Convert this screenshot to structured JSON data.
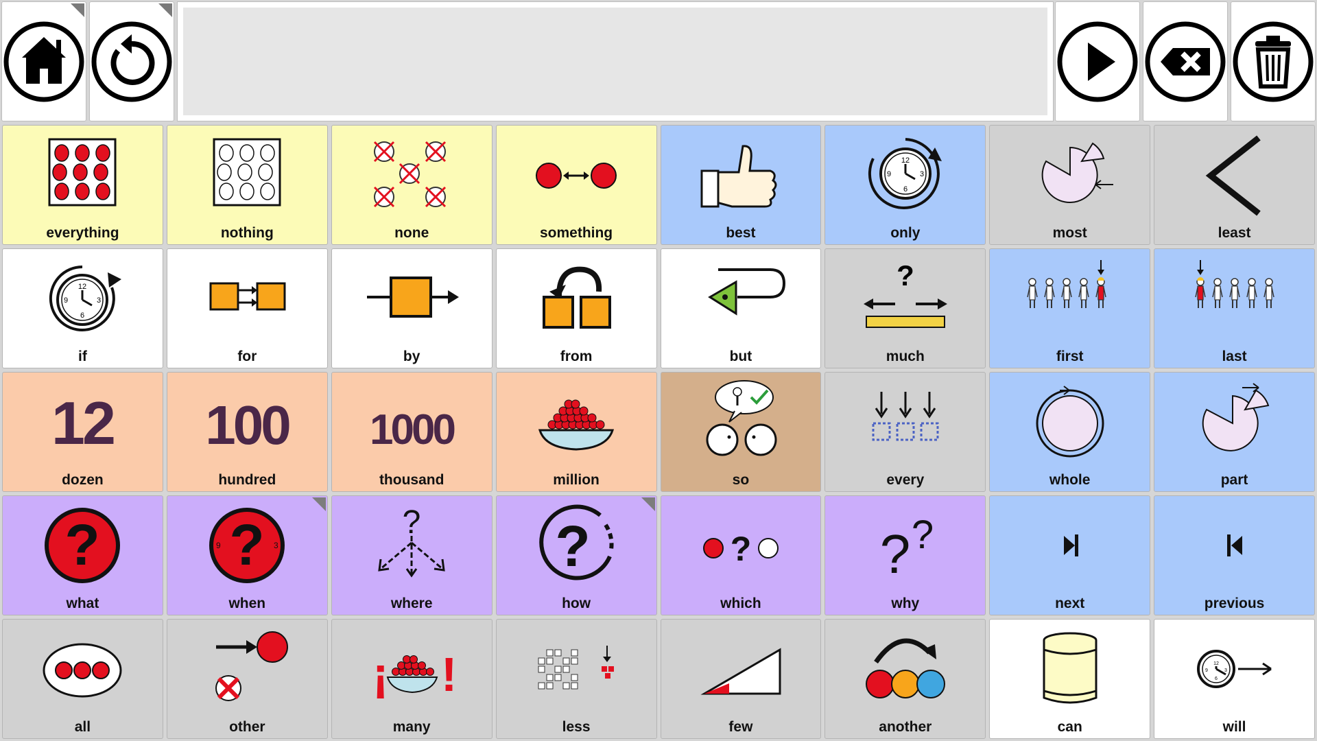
{
  "toolbar": {
    "left": [
      {
        "name": "home-button",
        "icon": "home-icon"
      },
      {
        "name": "back-button",
        "icon": "undo-icon"
      }
    ],
    "right": [
      {
        "name": "speak-button",
        "icon": "play-icon"
      },
      {
        "name": "backspace-button",
        "icon": "backspace-icon"
      },
      {
        "name": "clear-button",
        "icon": "trash-icon"
      }
    ],
    "message": ""
  },
  "colors": {
    "yellow": "#fcfbb7",
    "blue": "#a9c9fb",
    "gray": "#d1d1d1",
    "white": "#ffffff",
    "orange": "#fbcbaa",
    "brown": "#d4af8b",
    "purple": "#cbadfb",
    "red": "#e3101f"
  },
  "grid": [
    {
      "label": "everything",
      "color": "yellow",
      "icon": "everything-icon"
    },
    {
      "label": "nothing",
      "color": "yellow",
      "icon": "nothing-icon"
    },
    {
      "label": "none",
      "color": "yellow",
      "icon": "none-icon"
    },
    {
      "label": "something",
      "color": "yellow",
      "icon": "something-icon"
    },
    {
      "label": "best",
      "color": "blue",
      "icon": "thumbs-up-icon"
    },
    {
      "label": "only",
      "color": "blue",
      "icon": "clock-loop-icon"
    },
    {
      "label": "most",
      "color": "gray",
      "icon": "pie-most-icon"
    },
    {
      "label": "least",
      "color": "gray",
      "icon": "less-than-icon"
    },
    {
      "label": "if",
      "color": "white",
      "icon": "clock-if-icon"
    },
    {
      "label": "for",
      "color": "white",
      "icon": "for-icon"
    },
    {
      "label": "by",
      "color": "white",
      "icon": "by-icon"
    },
    {
      "label": "from",
      "color": "white",
      "icon": "from-icon"
    },
    {
      "label": "but",
      "color": "white",
      "icon": "but-icon"
    },
    {
      "label": "much",
      "color": "gray",
      "icon": "much-icon"
    },
    {
      "label": "first",
      "color": "blue",
      "icon": "first-icon"
    },
    {
      "label": "last",
      "color": "blue",
      "icon": "last-icon"
    },
    {
      "label": "dozen",
      "color": "orange",
      "icon": "number-12-icon",
      "numeral": "12"
    },
    {
      "label": "hundred",
      "color": "orange",
      "icon": "number-100-icon",
      "numeral": "100"
    },
    {
      "label": "thousand",
      "color": "orange",
      "icon": "number-1000-icon",
      "numeral": "1000"
    },
    {
      "label": "million",
      "color": "orange",
      "icon": "bowl-icon"
    },
    {
      "label": "so",
      "color": "brown",
      "icon": "so-icon"
    },
    {
      "label": "every",
      "color": "gray",
      "icon": "every-icon"
    },
    {
      "label": "whole",
      "color": "blue",
      "icon": "whole-icon"
    },
    {
      "label": "part",
      "color": "blue",
      "icon": "part-icon"
    },
    {
      "label": "what",
      "color": "purple",
      "icon": "question-icon"
    },
    {
      "label": "when",
      "color": "purple",
      "icon": "question-clock-icon",
      "folder": true
    },
    {
      "label": "where",
      "color": "purple",
      "icon": "where-icon"
    },
    {
      "label": "how",
      "color": "purple",
      "icon": "how-icon",
      "folder": true
    },
    {
      "label": "which",
      "color": "purple",
      "icon": "which-icon"
    },
    {
      "label": "why",
      "color": "purple",
      "icon": "why-icon"
    },
    {
      "label": "next",
      "color": "blue",
      "icon": "next-icon"
    },
    {
      "label": "previous",
      "color": "blue",
      "icon": "previous-icon"
    },
    {
      "label": "all",
      "color": "gray",
      "icon": "all-icon"
    },
    {
      "label": "other",
      "color": "gray",
      "icon": "other-icon"
    },
    {
      "label": "many",
      "color": "gray",
      "icon": "many-icon"
    },
    {
      "label": "less",
      "color": "gray",
      "icon": "less-icon"
    },
    {
      "label": "few",
      "color": "gray",
      "icon": "few-icon"
    },
    {
      "label": "another",
      "color": "gray",
      "icon": "another-icon"
    },
    {
      "label": "can",
      "color": "white",
      "icon": "can-icon"
    },
    {
      "label": "will",
      "color": "white",
      "icon": "will-icon"
    }
  ]
}
